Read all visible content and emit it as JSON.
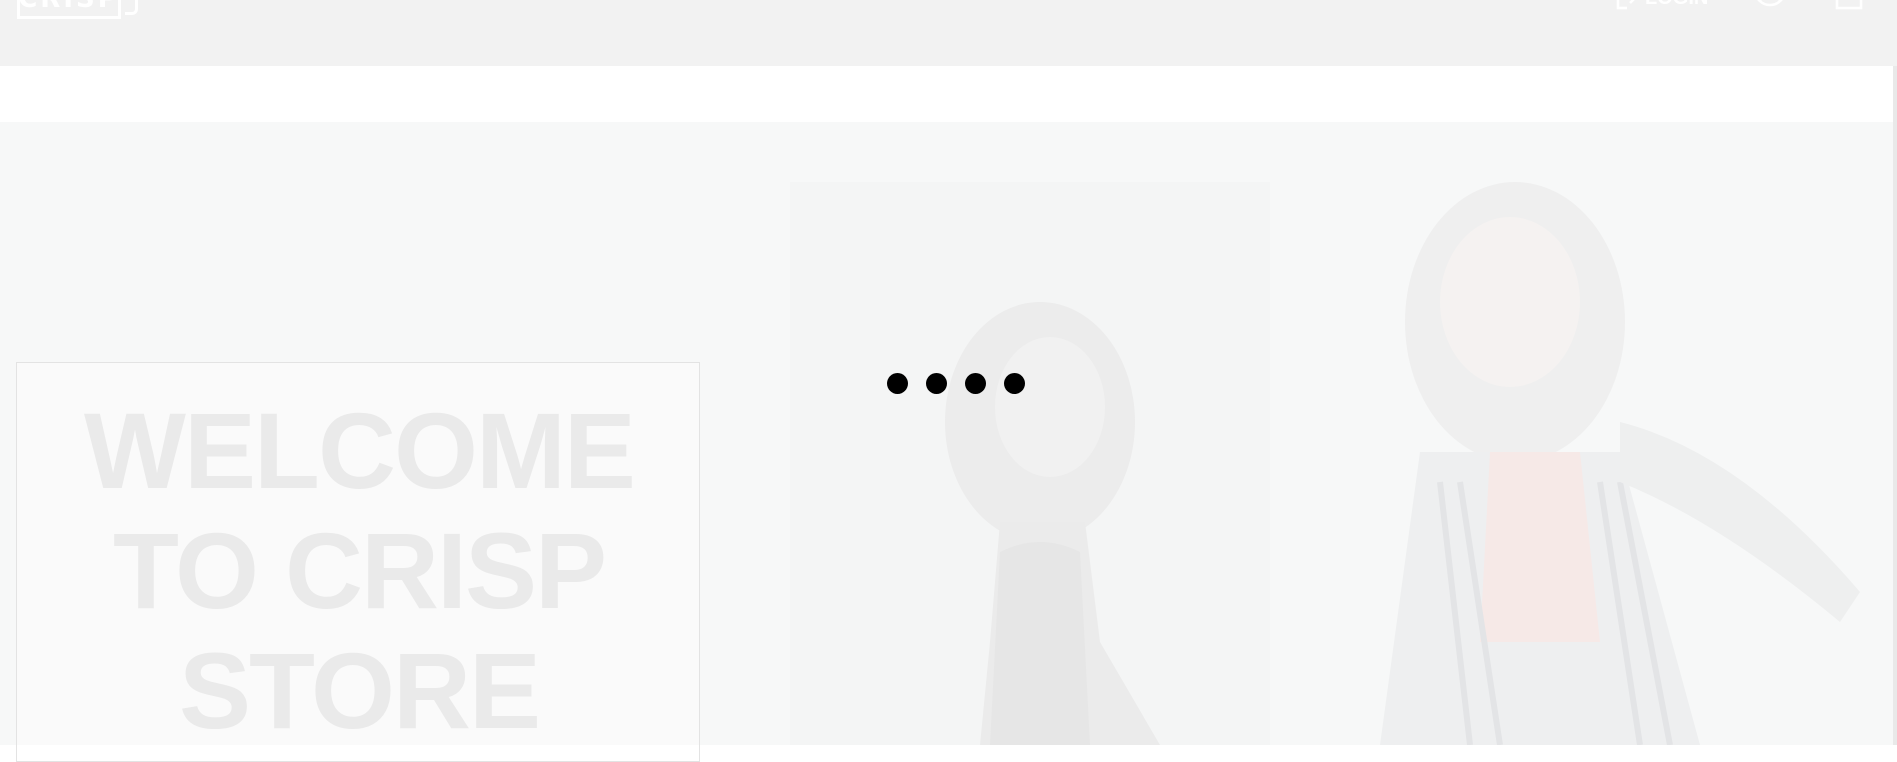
{
  "header": {
    "logo_text": "CRISP",
    "login_label": "LOGIN",
    "icons": [
      "login-arrow-icon",
      "user-circle-icon",
      "shopping-bag-icon"
    ]
  },
  "hero": {
    "welcome_text": "WELCOME\nTO CRISP\nSTORE",
    "loading_indicator": "four-dot-loader"
  },
  "colors": {
    "header_bg": "#f2f2f2",
    "hero_text": "#eaeaea",
    "loader": "#000000"
  }
}
